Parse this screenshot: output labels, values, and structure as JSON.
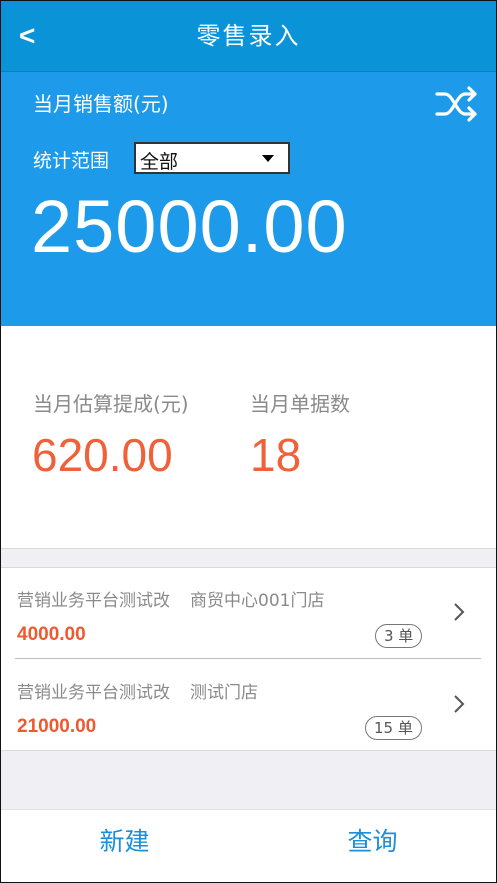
{
  "nav": {
    "back_glyph": "<",
    "title": "零售录入"
  },
  "hero": {
    "label": "当月销售额(元)",
    "range_label": "统计范围",
    "range_selected": "全部",
    "amount": "25000.00",
    "shuffle_icon": "shuffle-icon"
  },
  "stats": {
    "commission_label": "当月估算提成(元)",
    "commission_value": "620.00",
    "count_label": "当月单据数",
    "count_value": "18"
  },
  "list": [
    {
      "org": "营销业务平台测试改",
      "store": "商贸中心001门店",
      "amount": "4000.00",
      "badge": "3 单"
    },
    {
      "org": "营销业务平台测试改",
      "store": "测试门店",
      "amount": "21000.00",
      "badge": "15 单"
    }
  ],
  "bottom": {
    "new_label": "新建",
    "query_label": "查询"
  },
  "colors": {
    "nav": "#0b93d8",
    "hero": "#1d9bea",
    "accent": "#f0613a",
    "action": "#1d8fd6"
  }
}
